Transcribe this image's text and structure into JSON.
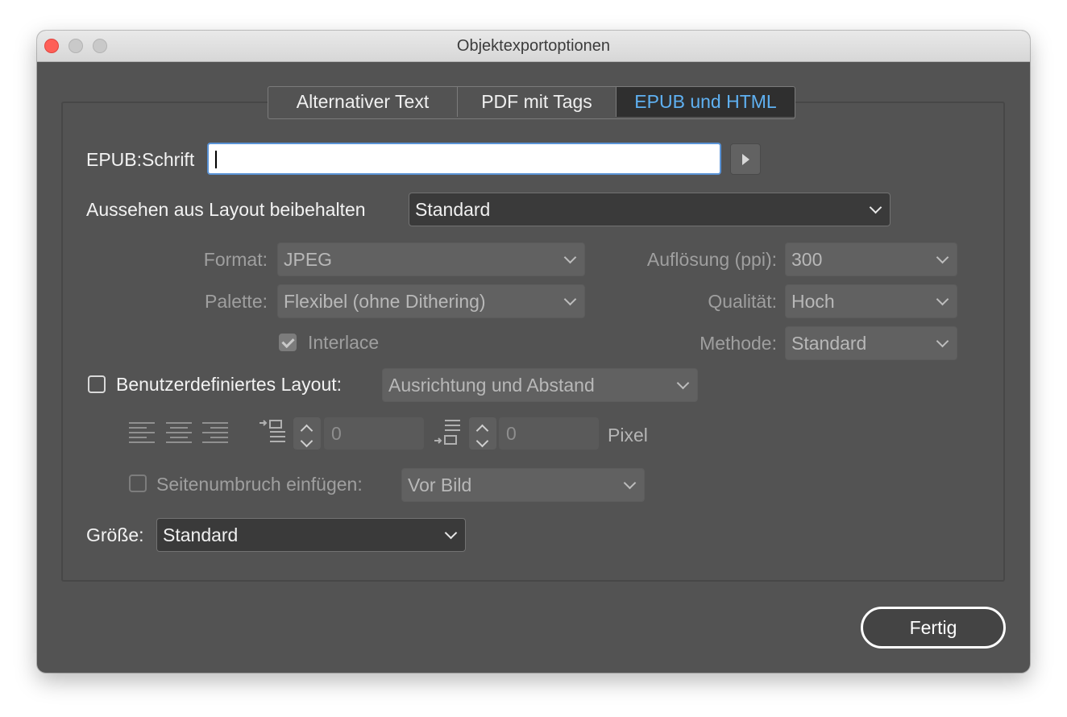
{
  "window": {
    "title": "Objektexportoptionen"
  },
  "tabs": [
    {
      "label": "Alternativer Text",
      "active": false
    },
    {
      "label": "PDF mit Tags",
      "active": false
    },
    {
      "label": "EPUB und HTML",
      "active": true
    }
  ],
  "epub_font": {
    "label": "EPUB:Schrift",
    "value": ""
  },
  "preserve_appearance": {
    "label": "Aussehen aus Layout beibehalten",
    "value": "Standard"
  },
  "image_settings": {
    "format": {
      "label": "Format:",
      "value": "JPEG"
    },
    "palette": {
      "label": "Palette:",
      "value": "Flexibel (ohne Dithering)"
    },
    "interlace": {
      "label": "Interlace",
      "checked": true
    },
    "resolution": {
      "label": "Auflösung (ppi):",
      "value": "300"
    },
    "quality": {
      "label": "Qualität:",
      "value": "Hoch"
    },
    "method": {
      "label": "Methode:",
      "value": "Standard"
    }
  },
  "custom_layout": {
    "label": "Benutzerdefiniertes Layout:",
    "checked": false,
    "value": "Ausrichtung und Abstand"
  },
  "spacing": {
    "before": "0",
    "after": "0",
    "unit": "Pixel"
  },
  "page_break": {
    "label": "Seitenumbruch einfügen:",
    "checked": false,
    "value": "Vor Bild"
  },
  "size": {
    "label": "Größe:",
    "value": "Standard"
  },
  "buttons": {
    "done": "Fertig"
  },
  "colors": {
    "accent": "#5fb1f2",
    "dialog_bg": "#535353",
    "close": "#fe5f57"
  }
}
